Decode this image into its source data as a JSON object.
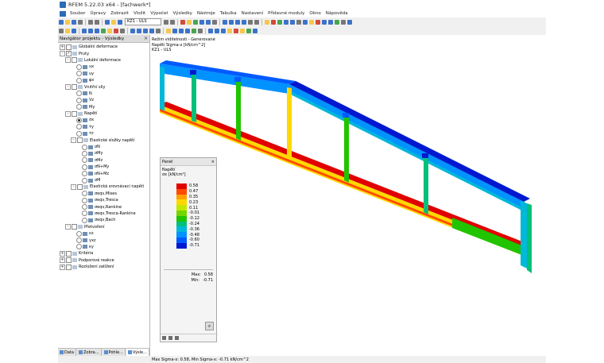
{
  "window": {
    "title": "RFEM 5.22.03 x64 - [fachwerk*]"
  },
  "menu": [
    "Soubor",
    "Úpravy",
    "Zobrazit",
    "Vložit",
    "Výpočet",
    "Výsledky",
    "Nástroje",
    "Tabulka",
    "Nastavení",
    "Přídavné moduly",
    "Okno",
    "Nápověda"
  ],
  "toolbar": {
    "loadcase_combo": "KZ1 - ULS"
  },
  "navigator": {
    "title": "Navigátor projektu - Výsledky",
    "items": [
      {
        "label": "Globální deformace",
        "depth": 0,
        "expander": "+",
        "control": "check",
        "checked": false
      },
      {
        "label": "Pruty",
        "depth": 0,
        "expander": "-",
        "control": "check",
        "checked": true
      },
      {
        "label": "Lokální deformace",
        "depth": 1,
        "expander": "-",
        "control": "check",
        "checked": false
      },
      {
        "label": "ux",
        "depth": 2,
        "control": "radio",
        "selected": false
      },
      {
        "label": "uy",
        "depth": 2,
        "control": "radio",
        "selected": false
      },
      {
        "label": "φx",
        "depth": 2,
        "control": "radio",
        "selected": false
      },
      {
        "label": "Vnitřní síly",
        "depth": 1,
        "expander": "-",
        "control": "check",
        "checked": false
      },
      {
        "label": "N",
        "depth": 2,
        "control": "radio",
        "selected": false
      },
      {
        "label": "Vz",
        "depth": 2,
        "control": "radio",
        "selected": false
      },
      {
        "label": "My",
        "depth": 2,
        "control": "radio",
        "selected": false
      },
      {
        "label": "Napětí",
        "depth": 1,
        "expander": "-",
        "control": "check",
        "checked": false
      },
      {
        "label": "σx",
        "depth": 2,
        "control": "radio",
        "selected": true
      },
      {
        "label": "τy",
        "depth": 2,
        "control": "radio",
        "selected": false
      },
      {
        "label": "τz",
        "depth": 2,
        "control": "radio",
        "selected": false
      },
      {
        "label": "Elastické složky napětí",
        "depth": 2,
        "expander": "-",
        "control": "check",
        "checked": false
      },
      {
        "label": "σN",
        "depth": 3,
        "control": "radio",
        "selected": false
      },
      {
        "label": "σMy",
        "depth": 3,
        "control": "radio",
        "selected": false
      },
      {
        "label": "σMz",
        "depth": 3,
        "control": "radio",
        "selected": false
      },
      {
        "label": "σN+My",
        "depth": 3,
        "control": "radio",
        "selected": false
      },
      {
        "label": "σN+Mz",
        "depth": 3,
        "control": "radio",
        "selected": false
      },
      {
        "label": "σM",
        "depth": 3,
        "control": "radio",
        "selected": false
      },
      {
        "label": "Elastická srovnávací napětí",
        "depth": 2,
        "expander": "-",
        "control": "check",
        "checked": false
      },
      {
        "label": "σeqv,Mises",
        "depth": 3,
        "control": "radio",
        "selected": false
      },
      {
        "label": "σeqv,Tresca",
        "depth": 3,
        "control": "radio",
        "selected": false
      },
      {
        "label": "σeqv,Rankine",
        "depth": 3,
        "control": "radio",
        "selected": false
      },
      {
        "label": "σeqv,Tresca-Rankine",
        "depth": 3,
        "control": "radio",
        "selected": false
      },
      {
        "label": "σeqv,Bach",
        "depth": 3,
        "control": "radio",
        "selected": false
      },
      {
        "label": "Přetvoření",
        "depth": 1,
        "expander": "-",
        "control": "check",
        "checked": false
      },
      {
        "label": "εx",
        "depth": 2,
        "control": "radio",
        "selected": false
      },
      {
        "label": "γxz",
        "depth": 2,
        "control": "radio",
        "selected": false
      },
      {
        "label": "κy",
        "depth": 2,
        "control": "radio",
        "selected": false
      },
      {
        "label": "Kritéria",
        "depth": 0,
        "expander": "+",
        "control": "check",
        "checked": false
      },
      {
        "label": "Podporové reakce",
        "depth": 0,
        "expander": "+",
        "control": "check",
        "checked": false
      },
      {
        "label": "Rozložení zatížení",
        "depth": 0,
        "expander": "+",
        "control": "check",
        "checked": false
      }
    ],
    "tabs": [
      "Data",
      "Zobra...",
      "Pohle...",
      "Výsle..."
    ]
  },
  "viewport": {
    "info_lines": [
      "Režim viditelnosti - Generované",
      "Napětí Sigma-x [kN/cm^2]",
      "KZ1 - ULS"
    ]
  },
  "panel": {
    "title": "Panel",
    "subtitle": "Napětí",
    "unit": "σx [kN/cm²]",
    "legend": [
      {
        "value": "0.58",
        "color": "#e10000"
      },
      {
        "value": "0.47",
        "color": "#ff4a00"
      },
      {
        "value": "0.35",
        "color": "#ff9f00"
      },
      {
        "value": "0.23",
        "color": "#ffd800"
      },
      {
        "value": "0.11",
        "color": "#c5e800"
      },
      {
        "value": "-0.01",
        "color": "#74d600"
      },
      {
        "value": "-0.12",
        "color": "#21c400"
      },
      {
        "value": "-0.24",
        "color": "#00c07a"
      },
      {
        "value": "-0.36",
        "color": "#00b8d8"
      },
      {
        "value": "-0.48",
        "color": "#0092ff"
      },
      {
        "value": "-0.60",
        "color": "#005aff"
      },
      {
        "value": "-0.71",
        "color": "#0019cf"
      }
    ],
    "max_label": "Max:",
    "max_value": "0.58",
    "min_label": "Min:",
    "min_value": "-0.71"
  },
  "statusbar": {
    "text": "Max Sigma-x: 0.58, Min Sigma-x: -0.71 kN/cm^2"
  }
}
